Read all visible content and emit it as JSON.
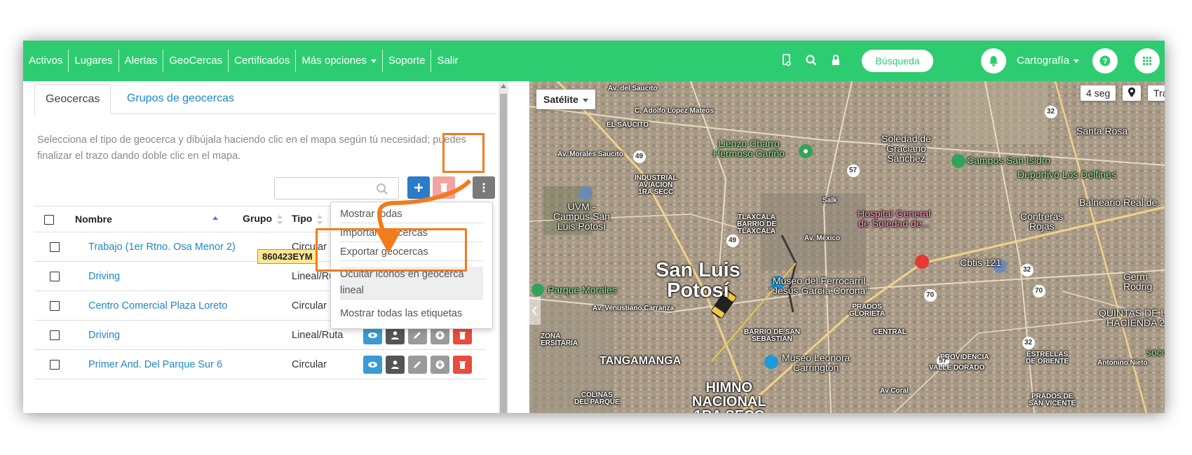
{
  "nav": {
    "links": [
      "Activos",
      "Lugares",
      "Alertas",
      "GeoCercas",
      "Certificados",
      "Más opciones",
      "Soporte",
      "Salir"
    ],
    "search_label": "Búsqueda",
    "cartography_label": "Cartografía"
  },
  "panel": {
    "tabs": [
      "Geocercas",
      "Grupos de geocercas"
    ],
    "hint": "Selecciona el tipo de geocerca y dibújala haciendo clic en el mapa según tú necesidad; puedes finalizar el trazo dando doble clic en el mapa.",
    "search_value": ""
  },
  "table": {
    "headers": {
      "name": "Nombre",
      "group": "Grupo",
      "type": "Tipo"
    },
    "rows": [
      {
        "name": "Trabajo (1er Rtno. Osa Menor 2)",
        "type": "Circular"
      },
      {
        "name": "Driving",
        "type": "Lineal/Ruta"
      },
      {
        "name": "Centro Comercial Plaza Loreto",
        "type": "Circular"
      },
      {
        "name": "Driving",
        "type": "Lineal/Ruta"
      },
      {
        "name": "Primer And. Del Parque Sur 6",
        "type": "Circular"
      }
    ]
  },
  "dropdown": {
    "items": [
      "Mostrar todas",
      "Importar geocercas",
      "Exportar geocercas",
      "Ocultar iconos en geocerca lineal",
      "Mostrar todas las etiquetas"
    ]
  },
  "map": {
    "type_label": "Satélite",
    "refresh_label": "4 seg",
    "traffic_label": "Tráfico",
    "vehicle_plate": "860423EYM",
    "labels": {
      "adolfo": "C. Adolfo López Mateos",
      "saucito": "EL SAUCITO",
      "lienzo": "Lienzo Charro\nHermoso Cariño",
      "soledad": "Soledad de\nGraciano\nSánchez",
      "santa_rosa": "Santa Rosa",
      "campos": "Campos San Isidro",
      "deportivo": "Deportivo Los Delfines",
      "balneario": "Balneario Real de",
      "industrial": "INDUSTRIAL\nAVIACION\n1RA SECC",
      "uvm": "UVM -\nCampus San\nLuis Potosí",
      "tlaxcala": "TLAXCALA\nBARRIO DE\nTLAXCALA",
      "hospital": "Hospital General\nde Soledad de...",
      "contreras": "Contreras\nRojas",
      "san_luis": "San Luis\nPotosí",
      "cbtis": "Cbtis 121",
      "museo_ferro": "Museo del Ferrocarril\n\"Jesús García Corona\"",
      "parque": "Parque Morales",
      "prados": "PRADOS\nGLORIETA",
      "venustiano": "Av. Venustiano Carranza",
      "quintas": "QUINTAS DE LA\nHACIENDA 2",
      "zona": "ZONA\nERSITARIA",
      "barrio_san": "BARRIO DE SAN\nSEBASTIAN",
      "central": "CENTRAL",
      "tangamanga": "TANGAMANGA",
      "museo_leonora": "Museo Leonora\nCarrington",
      "providencia": "PROVIDENCIA",
      "valle": "VALLE DORADO",
      "estrellas": "ESTRELLAS\nDE ORIENTE",
      "antonino": "Antonino Nieto",
      "himno": "HIMNO\nNACIONAL\n1RA SECC",
      "colinas": "COLINAS\nDEL PARQUE",
      "prados_sv": "PRADOS DE\nSAN VICENTE",
      "av_coral": "Av Coral",
      "germ": "Germ\nRodrig",
      "socc": "socc",
      "mexico": "Av. México",
      "salk": "Salk",
      "saucito_av": "Av. Morales Saucito",
      "sal_label": "Av. del Saucito",
      "r49": "49",
      "r57": "57",
      "r70": "70",
      "r32": "32"
    }
  },
  "colors": {
    "green": "#2ecc71",
    "blue_link": "#1e88c9",
    "orange_annotation": "#f27b1c",
    "btn_blue": "#2b7bc6",
    "btn_red": "#e74c3c",
    "btn_dark": "#555555",
    "btn_teal": "#3a9bd5"
  }
}
